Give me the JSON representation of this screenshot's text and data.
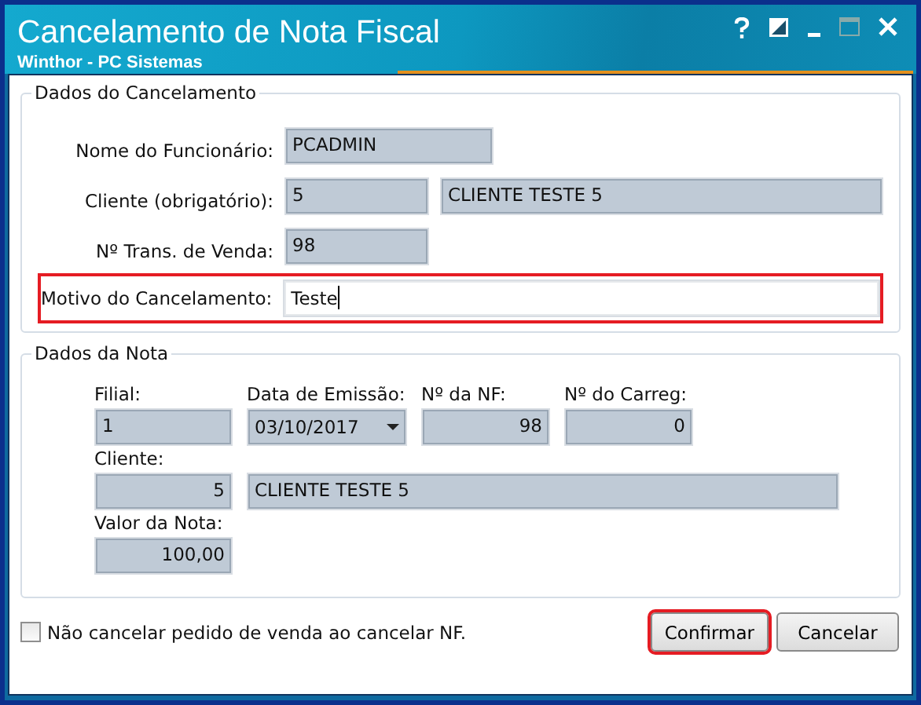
{
  "window": {
    "title": "Cancelamento de Nota Fiscal",
    "subtitle": "Winthor - PC Sistemas"
  },
  "cancelamento": {
    "legend": "Dados do Cancelamento",
    "funcionario": {
      "label": "Nome do Funcionário:",
      "value": "PCADMIN"
    },
    "cliente": {
      "label": "Cliente (obrigatório):",
      "code": "5",
      "name": "CLIENTE TESTE 5"
    },
    "transacao": {
      "label": "Nº Trans. de Venda:",
      "value": "98"
    },
    "motivo": {
      "label": "Motivo do Cancelamento:",
      "value": "Teste",
      "highlighted": true
    }
  },
  "nota": {
    "legend": "Dados da Nota",
    "filial": {
      "label": "Filial:",
      "value": "1"
    },
    "emissao": {
      "label": "Data de Emissão:",
      "value": "03/10/2017"
    },
    "numero": {
      "label": "Nº da NF:",
      "value": "98"
    },
    "carregamento": {
      "label": "Nº do Carreg:",
      "value": "0"
    },
    "cliente": {
      "label": "Cliente:",
      "code": "5",
      "name": "CLIENTE TESTE 5"
    },
    "valor": {
      "label": "Valor da Nota:",
      "value": "100,00"
    }
  },
  "option": {
    "label": "Não cancelar pedido de venda ao cancelar NF.",
    "checked": false
  },
  "buttons": [
    {
      "label": "Confirmar",
      "highlighted": true
    },
    {
      "label": "Cancelar",
      "highlighted": false
    }
  ]
}
